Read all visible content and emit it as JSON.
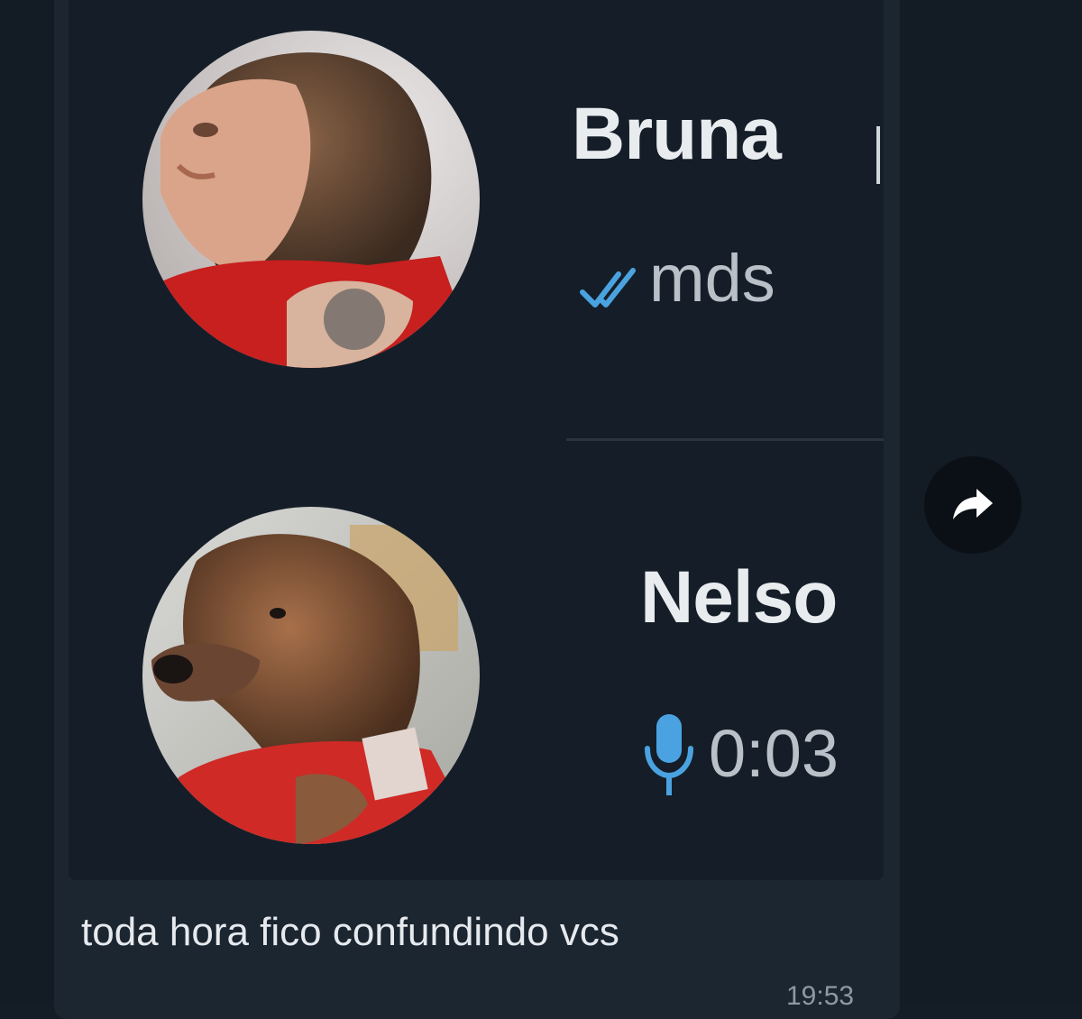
{
  "contacts": [
    {
      "name": "Bruna",
      "preview": "mds",
      "status_icon": "double-check-icon",
      "avatar": "woman-photo"
    },
    {
      "name": "Nelso",
      "preview": "0:03",
      "status_icon": "microphone-icon",
      "avatar": "dog-photo"
    }
  ],
  "message": {
    "text": "toda hora fico confundindo vcs",
    "time": "19:53"
  },
  "colors": {
    "background": "#131b24",
    "bubble": "#1c2631",
    "card": "#151e28",
    "check": "#4aa3e0",
    "mic": "#4aa3e0"
  },
  "actions": {
    "forward_icon": "forward-arrow-icon"
  }
}
